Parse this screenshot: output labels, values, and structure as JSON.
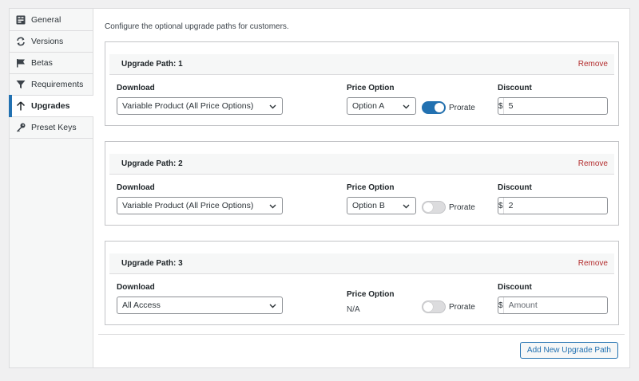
{
  "sidebar": {
    "items": [
      {
        "label": "General",
        "icon": "general-icon"
      },
      {
        "label": "Versions",
        "icon": "sync-icon"
      },
      {
        "label": "Betas",
        "icon": "flag-icon"
      },
      {
        "label": "Requirements",
        "icon": "filter-icon"
      },
      {
        "label": "Upgrades",
        "icon": "arrow-up-icon",
        "active": true
      },
      {
        "label": "Preset Keys",
        "icon": "key-icon"
      }
    ]
  },
  "intro_text": "Configure the optional upgrade paths for customers.",
  "labels": {
    "download": "Download",
    "price_option": "Price Option",
    "discount": "Discount",
    "prorate": "Prorate",
    "remove": "Remove",
    "currency": "$"
  },
  "paths": [
    {
      "title": "Upgrade Path: 1",
      "download": "Variable Product (All Price Options)",
      "price_option": "Option A",
      "prorate": true,
      "discount_value": "5",
      "discount_placeholder": "Amount"
    },
    {
      "title": "Upgrade Path: 2",
      "download": "Variable Product (All Price Options)",
      "price_option": "Option B",
      "prorate": false,
      "discount_value": "2",
      "discount_placeholder": "Amount"
    },
    {
      "title": "Upgrade Path: 3",
      "download": "All Access",
      "price_option_na": "N/A",
      "prorate": false,
      "discount_value": "",
      "discount_placeholder": "Amount"
    }
  ],
  "add_button": "Add New Upgrade Path",
  "colors": {
    "accent": "#2271b1",
    "danger": "#b32d2e",
    "border": "#c3c4c7"
  }
}
